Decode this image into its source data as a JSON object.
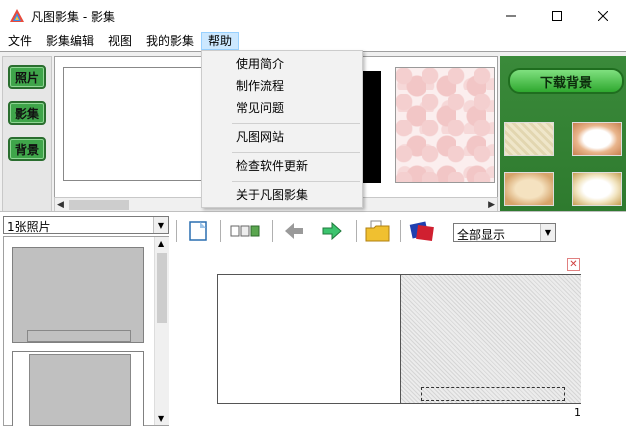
{
  "window": {
    "title": "凡图影集 - 影集",
    "app_icon": "colorful-triangle-app-icon"
  },
  "menubar": {
    "items": [
      {
        "label": "文件"
      },
      {
        "label": "影集编辑"
      },
      {
        "label": "视图"
      },
      {
        "label": "我的影集"
      },
      {
        "label": "帮助",
        "active": true
      }
    ]
  },
  "help_menu": {
    "items": [
      {
        "label": "使用简介"
      },
      {
        "label": "制作流程"
      },
      {
        "label": "常见问题"
      },
      {
        "label": "凡图网站"
      },
      {
        "label": "检查软件更新"
      },
      {
        "label": "关于凡图影集"
      }
    ]
  },
  "side_tabs": {
    "photo": "照片",
    "album": "影集",
    "background": "背景"
  },
  "background_panel": {
    "download_label": "下载背景",
    "accent_color": "#2e7a2e"
  },
  "photo_panel": {
    "count_label": "1张照片"
  },
  "toolbar": {
    "view_select": "全部显示",
    "icons": [
      "new-page-icon",
      "layout-icon",
      "back-arrow-icon",
      "forward-arrow-icon",
      "open-folder-icon",
      "cards-icon"
    ]
  },
  "canvas": {
    "page_number": "1"
  },
  "colors": {
    "menu_highlight": "#cce8ff",
    "tab_green": "#3fa54a"
  }
}
